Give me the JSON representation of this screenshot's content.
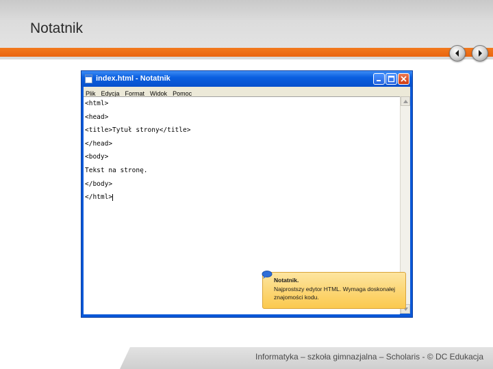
{
  "slide": {
    "title": "Notatnik",
    "footer": "Informatyka – szkoła gimnazjalna – Scholaris - © DC Edukacja",
    "nav_prev_icon": "arrow-left-icon",
    "nav_next_icon": "arrow-right-icon"
  },
  "window": {
    "title": "index.html - Notatnik",
    "menu": [
      "Plik",
      "Edycja",
      "Format",
      "Widok",
      "Pomoc"
    ],
    "lines": [
      "<html>",
      "<head>",
      "<title>Tytuł strony</title>",
      "</head>",
      "<body>",
      "Tekst na stronę.",
      "</body>",
      "</html>"
    ]
  },
  "callout": {
    "title": "Notatnik.",
    "text": "Najprostszy edytor HTML. Wymaga doskonałej znajomości kodu."
  },
  "colors": {
    "accent": "#ea6510",
    "titlebar": "#0a58d8",
    "callout": "#fbc94e"
  }
}
